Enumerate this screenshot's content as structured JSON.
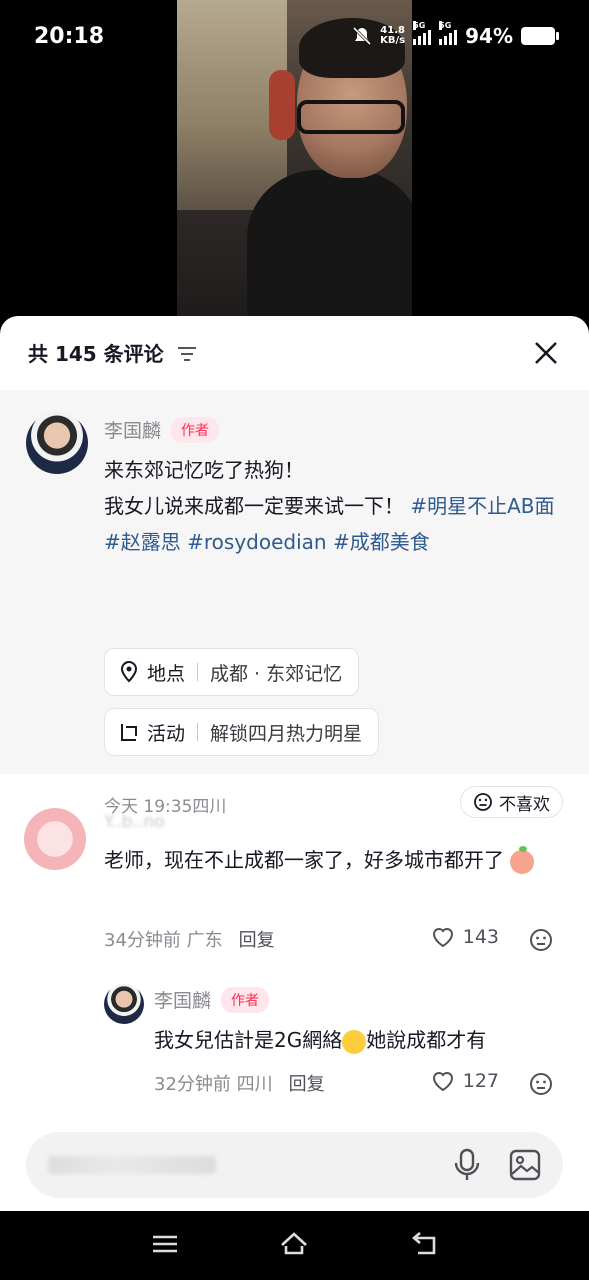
{
  "status_bar": {
    "time": "20:18",
    "net_speed_value": "41.8",
    "net_speed_unit": "KB/s",
    "sim1_tag": "5G",
    "sim2_tag": "5G",
    "battery": "94%"
  },
  "sheet": {
    "title": "共 145 条评论"
  },
  "post": {
    "author": "李国麟",
    "author_badge": "作者",
    "text_line1": "来东郊记忆吃了热狗！",
    "text_line2_prefix": "我女儿说来成都一定要来试一下！",
    "hashtags": [
      "#明星不止AB面",
      "#赵露思",
      "#rosydoedian",
      "#成都美食"
    ],
    "location_label": "地点",
    "location_value": "成都 · 东郊记忆",
    "activity_label": "活动",
    "activity_value": "解锁四月热力明星",
    "time_location": "今天 19:35四川",
    "dislike_label": "不喜欢"
  },
  "comments": [
    {
      "name": "Y..b..no",
      "text": "老师，现在不止成都一家了，好多城市都开了",
      "time_location": "34分钟前 广东",
      "reply_label": "回复",
      "likes": "143"
    },
    {
      "name": "李国麟",
      "badge": "作者",
      "text_a": "我女兒估計是2G網絡",
      "text_b": "她說成都才有",
      "time_location": "32分钟前 四川",
      "reply_label": "回复",
      "likes": "127"
    }
  ],
  "icons": {
    "filter": "filter-icon",
    "close": "close-icon",
    "location": "location-pin-icon",
    "activity": "activity-icon",
    "dislike": "dislike-face-icon",
    "like": "heart-icon",
    "mic": "mic-icon",
    "image": "image-icon"
  }
}
